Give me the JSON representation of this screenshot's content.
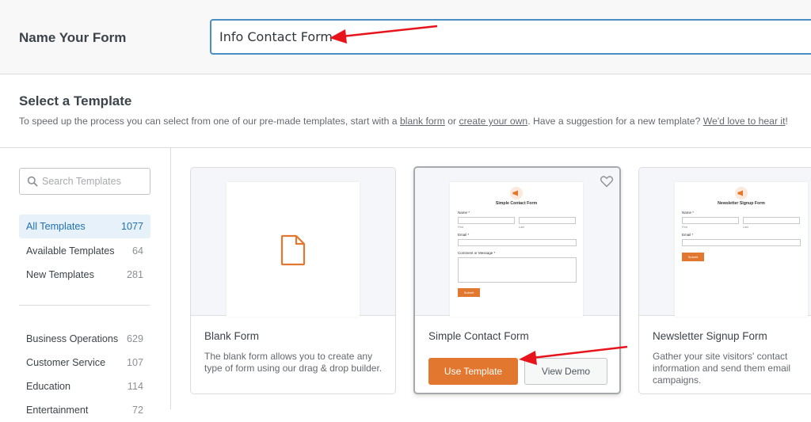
{
  "form_name": {
    "label": "Name Your Form",
    "value": "Info Contact Form"
  },
  "select_template": {
    "title": "Select a Template",
    "desc_prefix": "To speed up the process you can select from one of our pre-made templates, start with a ",
    "link_blank": "blank form",
    "desc_or": " or ",
    "link_create": "create your own",
    "desc_mid": ". Have a suggestion for a new template? ",
    "link_love": "We'd love to hear it",
    "desc_end": "!"
  },
  "sidebar": {
    "search_placeholder": "Search Templates",
    "categories": [
      {
        "label": "All Templates",
        "count": "1077"
      },
      {
        "label": "Available Templates",
        "count": "64"
      },
      {
        "label": "New Templates",
        "count": "281"
      }
    ],
    "groups": [
      {
        "label": "Business Operations",
        "count": "629"
      },
      {
        "label": "Customer Service",
        "count": "107"
      },
      {
        "label": "Education",
        "count": "114"
      },
      {
        "label": "Entertainment",
        "count": "72"
      }
    ]
  },
  "cards": [
    {
      "title": "Blank Form",
      "desc": "The blank form allows you to create any type of form using our drag & drop builder."
    },
    {
      "title": "Simple Contact Form",
      "use_label": "Use Template",
      "demo_label": "View Demo",
      "preview": {
        "title": "Simple Contact Form",
        "name_label": "Name *",
        "first": "First",
        "last": "Last",
        "email_label": "Email *",
        "comment_label": "Comment or Message *",
        "submit": "Submit"
      }
    },
    {
      "title": "Newsletter Signup Form",
      "desc": "Gather your site visitors' contact information and send them email campaigns.",
      "preview": {
        "title": "Newsletter Signup Form",
        "name_label": "Name *",
        "first": "First",
        "last": "Last",
        "email_label": "Email *",
        "submit": "Submit"
      }
    }
  ],
  "colors": {
    "accent": "#e27730",
    "link_active": "#2271b1",
    "annotation_arrow": "#e8141c"
  },
  "icons": [
    "search-icon",
    "file-icon",
    "heart-icon",
    "megaphone-icon"
  ]
}
